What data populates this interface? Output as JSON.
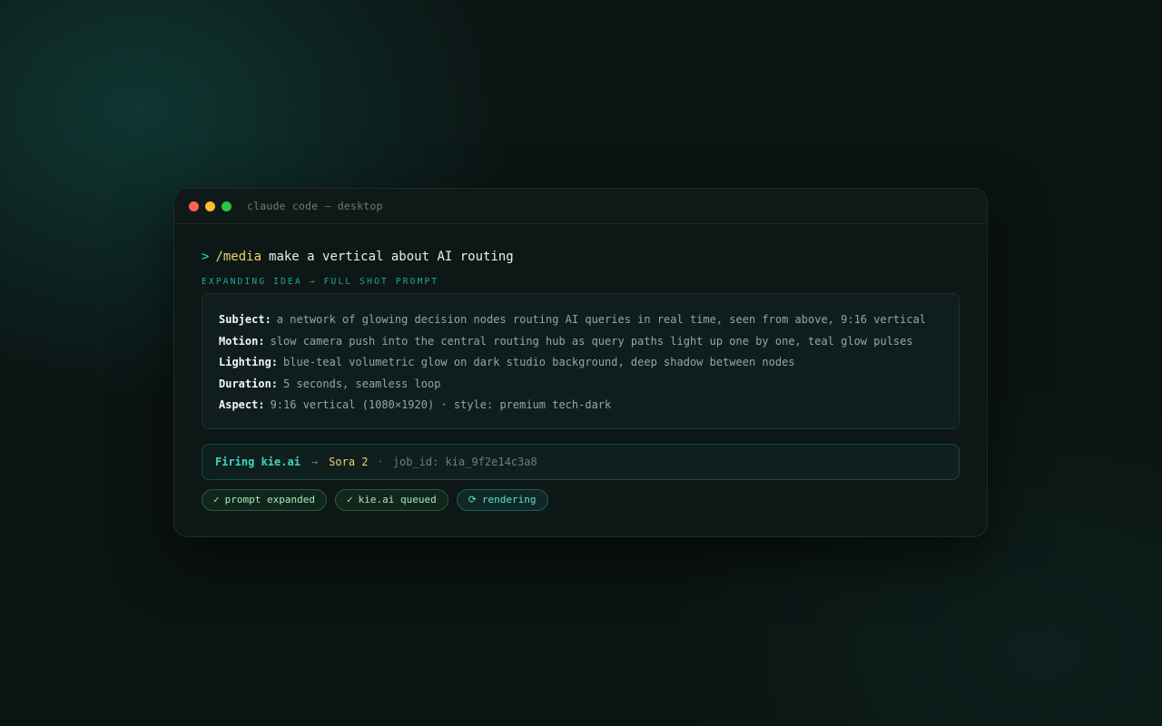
{
  "window": {
    "title": "claude code — desktop"
  },
  "prompt": {
    "caret": ">",
    "command": "/media",
    "text": "make a vertical about AI routing"
  },
  "section_label": "EXPANDING IDEA → FULL SHOT PROMPT",
  "shot_prompt": {
    "fields": [
      {
        "key": "Subject:",
        "value": "a network of glowing decision nodes routing AI queries in real time, seen from above, 9:16 vertical"
      },
      {
        "key": "Motion:",
        "value": "slow camera push into the central routing hub as query paths light up one by one, teal glow pulses"
      },
      {
        "key": "Lighting:",
        "value": "blue-teal volumetric glow on dark studio background, deep shadow between nodes"
      },
      {
        "key": "Duration:",
        "value": "5 seconds, seamless loop"
      },
      {
        "key": "Aspect:",
        "value": "9:16 vertical (1080×1920) · style: premium tech-dark"
      }
    ]
  },
  "firing": {
    "label": "Firing kie.ai",
    "arrow": "→",
    "model": "Sora 2",
    "separator": "·",
    "job": "job_id: kia_9f2e14c3a8"
  },
  "status_chips": [
    {
      "icon": "check-icon",
      "glyph": "✓",
      "label": "prompt expanded",
      "state": "done"
    },
    {
      "icon": "check-icon",
      "glyph": "✓",
      "label": "kie.ai queued",
      "state": "done"
    },
    {
      "icon": "refresh-icon",
      "glyph": "⟳",
      "label": "rendering",
      "state": "active"
    }
  ],
  "colors": {
    "accent_teal": "#3fd6c3",
    "accent_yellow": "#f2cf6e",
    "traffic_red": "#ff5f57",
    "traffic_yellow": "#febc2e",
    "traffic_green": "#28c840"
  }
}
